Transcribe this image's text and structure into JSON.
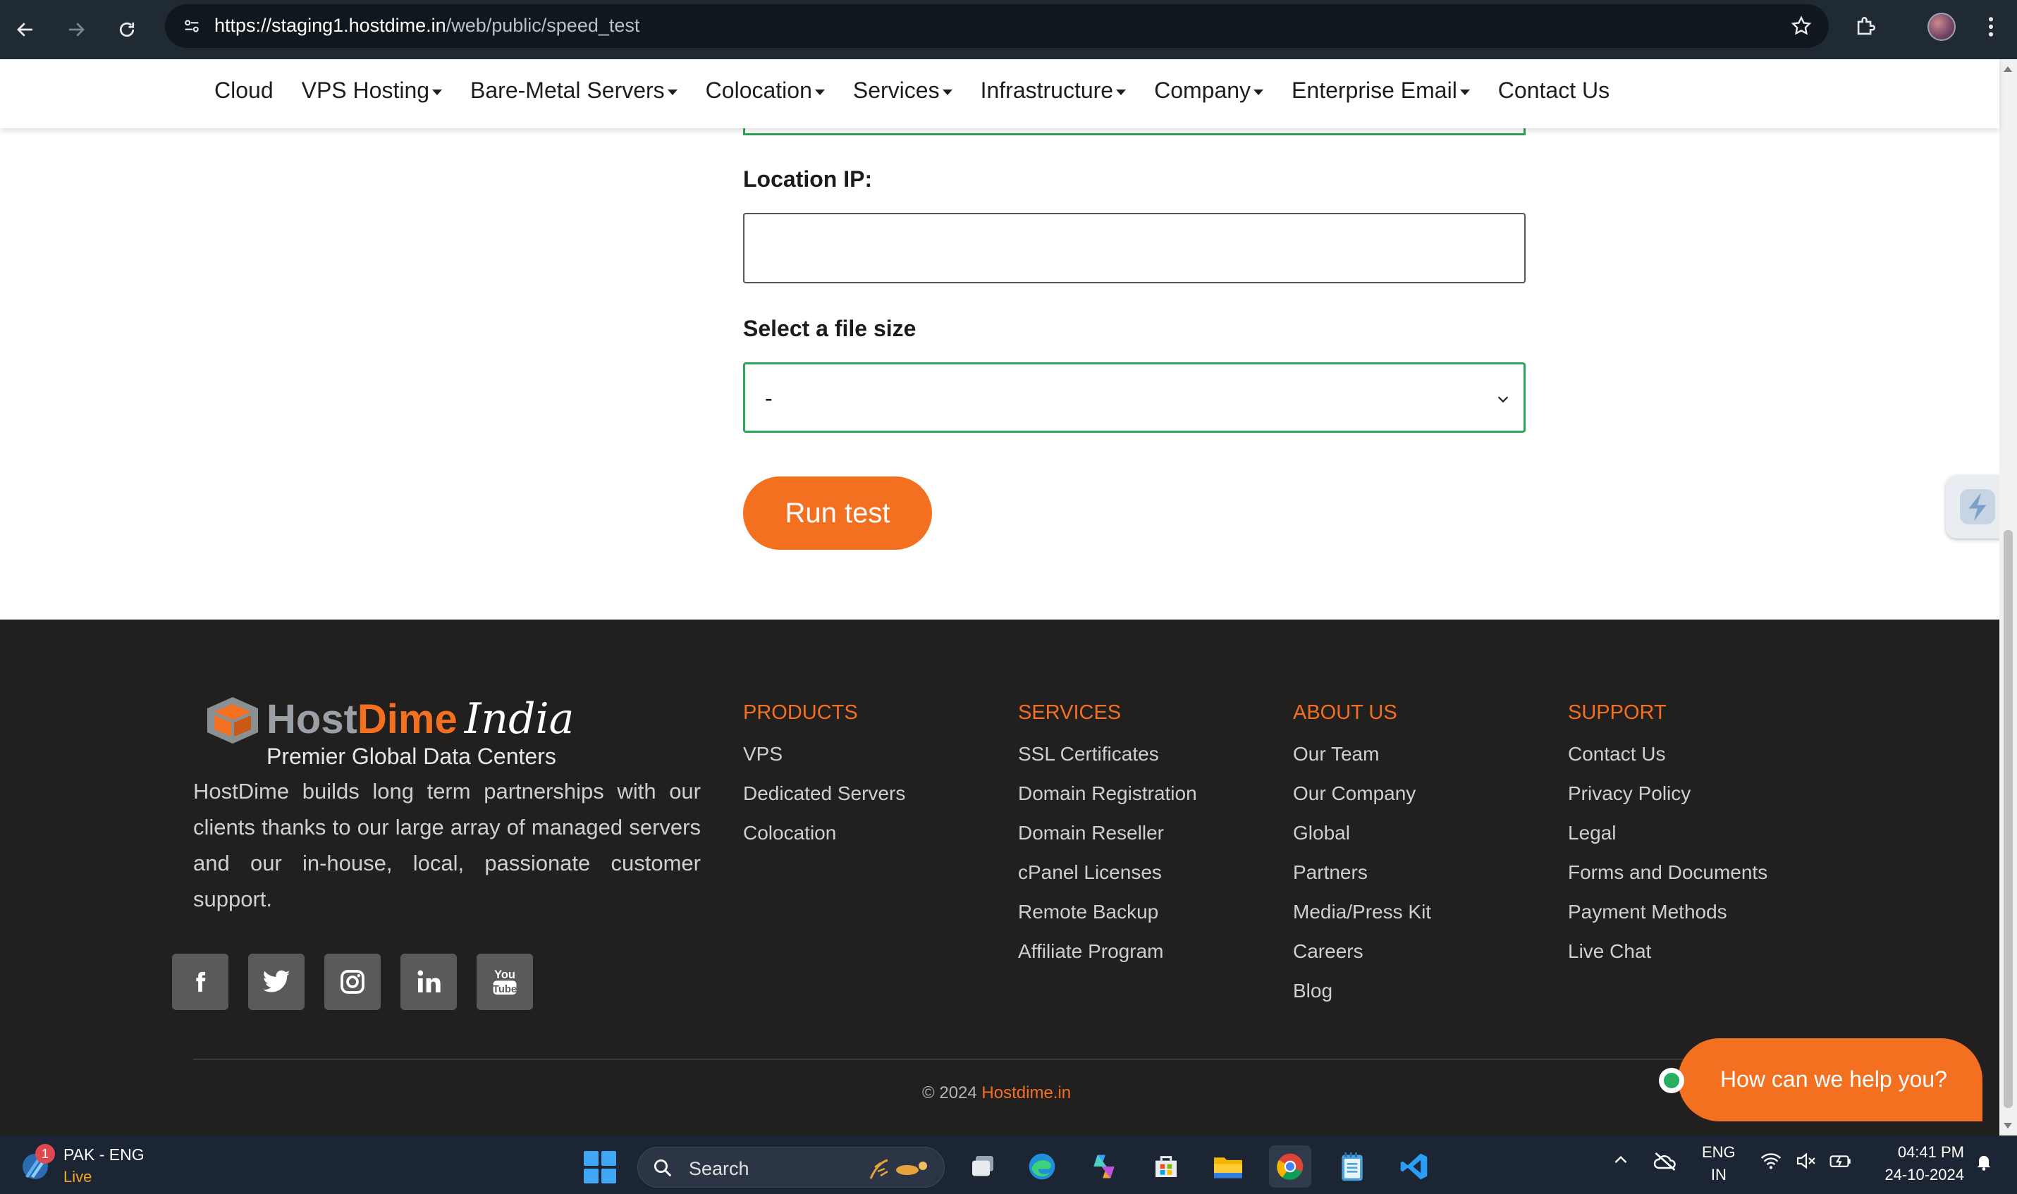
{
  "browser": {
    "url_host": "https://staging1.hostdime.in",
    "url_path": "/web/public/speed_test"
  },
  "nav": {
    "items": [
      {
        "label": "Cloud",
        "dropdown": false
      },
      {
        "label": "VPS Hosting",
        "dropdown": true
      },
      {
        "label": "Bare-Metal Servers",
        "dropdown": true
      },
      {
        "label": "Colocation",
        "dropdown": true
      },
      {
        "label": "Services",
        "dropdown": true
      },
      {
        "label": "Infrastructure",
        "dropdown": true
      },
      {
        "label": "Company",
        "dropdown": true
      },
      {
        "label": "Enterprise Email",
        "dropdown": true
      },
      {
        "label": "Contact Us",
        "dropdown": false
      }
    ]
  },
  "form": {
    "location_ip_label": "Location IP:",
    "location_ip_value": "",
    "file_size_label": "Select a file size",
    "file_size_value": "-",
    "run_button": "Run test"
  },
  "footer": {
    "logo": {
      "host": "Host",
      "dime": "Dime",
      "india": "India",
      "tagline": "Premier Global Data Centers"
    },
    "about": "HostDime builds long term partnerships with our clients thanks to our large array of managed servers and our in-house, local, passionate customer support.",
    "socials": [
      "facebook",
      "twitter",
      "instagram",
      "linkedin",
      "youtube"
    ],
    "columns": [
      {
        "title": "PRODUCTS",
        "links": [
          "VPS",
          "Dedicated Servers",
          "Colocation"
        ]
      },
      {
        "title": "SERVICES",
        "links": [
          "SSL Certificates",
          "Domain Registration",
          "Domain Reseller",
          "cPanel Licenses",
          "Remote Backup",
          "Affiliate Program"
        ]
      },
      {
        "title": "ABOUT US",
        "links": [
          "Our Team",
          "Our Company",
          "Global",
          "Partners",
          "Media/Press Kit",
          "Careers",
          "Blog"
        ]
      },
      {
        "title": "SUPPORT",
        "links": [
          "Contact Us",
          "Privacy Policy",
          "Legal",
          "Forms and Documents",
          "Payment Methods",
          "Live Chat"
        ]
      }
    ],
    "copyright_prefix": "© 2024",
    "copyright_link": "Hostdime.in"
  },
  "chat": {
    "label": "How can we help you?"
  },
  "taskbar": {
    "weather_badge": "1",
    "weather_title": "PAK - ENG",
    "weather_sub": "Live",
    "search_placeholder": "Search",
    "lang_top": "ENG",
    "lang_bottom": "IN",
    "time": "04:41 PM",
    "date": "24-10-2024"
  },
  "colors": {
    "accent": "#f37021",
    "footer_bg": "#221f1f",
    "select_border": "#2ea35a"
  }
}
